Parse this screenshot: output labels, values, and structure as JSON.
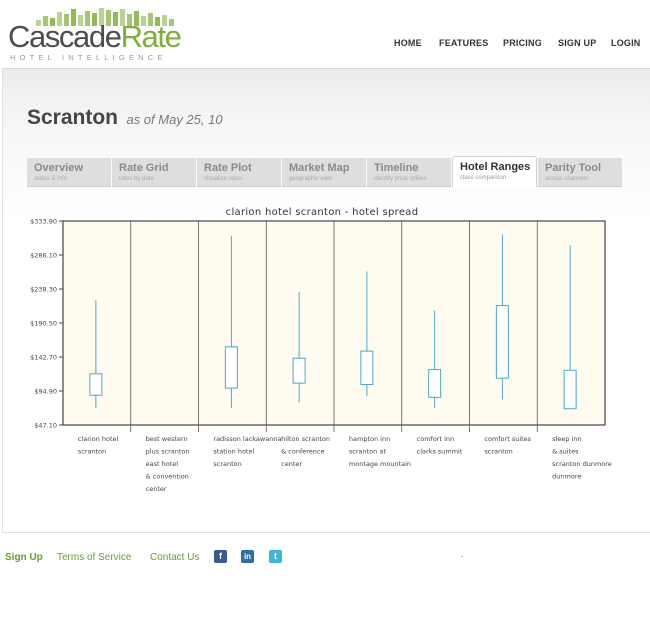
{
  "brand": {
    "word_left": "Cascade",
    "word_right": "Rate",
    "tagline": "HOTEL INTELLIGENCE",
    "colors": {
      "green": "#7fae3a",
      "gray": "#4d4d4d"
    }
  },
  "nav": [
    "HOME",
    "FEATURES",
    "PRICING",
    "SIGN UP",
    "LOGIN"
  ],
  "page": {
    "city": "Scranton",
    "as_of": "as of May 25, 10"
  },
  "tabs": [
    {
      "title": "Overview",
      "sub": "status & info",
      "active": false
    },
    {
      "title": "Rate Grid",
      "sub": "rates by date",
      "active": false
    },
    {
      "title": "Rate Plot",
      "sub": "visualize rates",
      "active": false
    },
    {
      "title": "Market Map",
      "sub": "geographic view",
      "active": false
    },
    {
      "title": "Timeline",
      "sub": "identify price spikes",
      "active": false
    },
    {
      "title": "Hotel Ranges",
      "sub": "class comparison",
      "active": true
    },
    {
      "title": "Parity Tool",
      "sub": "across channels",
      "active": false
    }
  ],
  "chart_data": {
    "type": "box",
    "title": "clarion hotel scranton - hotel spread",
    "yticks": [
      "$333.90",
      "$286.10",
      "$238.30",
      "$190.50",
      "$142.70",
      "$94.90",
      "$47.10"
    ],
    "ylim": [
      47.1,
      333.9
    ],
    "categories": [
      [
        "clarion hotel",
        "scranton"
      ],
      [
        "best western",
        "plus scranton",
        "east hotel",
        "& convention",
        "center"
      ],
      [
        "radisson lackawanna",
        "station hotel",
        "scranton"
      ],
      [
        "hilton scranton",
        "& conference",
        "center"
      ],
      [
        "hampton inn",
        "scranton at",
        "montage mountain"
      ],
      [
        "comfort inn",
        "clarks summit"
      ],
      [
        "comfort suites",
        "scranton"
      ],
      [
        "sleep inn",
        "& suites",
        "scranton dunmore",
        "dunmore"
      ]
    ],
    "boxes": [
      {
        "min": 71,
        "q1": 89,
        "q3": 119,
        "max": 223
      },
      null,
      {
        "min": 71,
        "q1": 99,
        "q3": 157,
        "max": 313
      },
      {
        "min": 79,
        "q1": 106,
        "q3": 141,
        "max": 234
      },
      {
        "min": 88,
        "q1": 104,
        "q3": 151,
        "max": 263
      },
      {
        "min": 71,
        "q1": 86,
        "q3": 125,
        "max": 208
      },
      {
        "min": 83,
        "q1": 113,
        "q3": 215,
        "max": 315
      },
      {
        "min": 70,
        "q1": 70,
        "q3": 124,
        "max": 300
      }
    ],
    "colors": {
      "box": "#4aa8c9",
      "plot_bg": "#fffcef",
      "grid": "#555555"
    }
  },
  "footer": {
    "links": [
      "Sign Up",
      "Terms of Service",
      "Contact Us"
    ],
    "social": [
      {
        "icon": "facebook-icon",
        "glyph": "f",
        "color": "#3b5998"
      },
      {
        "icon": "linkedin-icon",
        "glyph": "in",
        "color": "#2a6fa8"
      },
      {
        "icon": "twitter-icon",
        "glyph": "t",
        "color": "#39b7e0"
      }
    ]
  }
}
